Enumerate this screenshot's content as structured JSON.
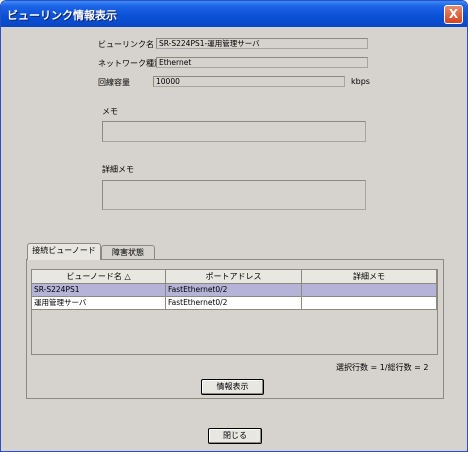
{
  "window": {
    "title": "ビューリンク情報表示",
    "close_label": "X"
  },
  "form": {
    "viewlink_name_label": "ビューリンク名",
    "viewlink_name_value": "SR-S224PS1-運用管理サーバ",
    "network_type_label": "ネットワーク種別",
    "network_type_value": "Ethernet",
    "line_capacity_label": "回線容量",
    "line_capacity_value": "10000",
    "line_capacity_unit": "kbps",
    "memo_label": "メモ",
    "memo_value": "",
    "detail_memo_label": "詳細メモ",
    "detail_memo_value": ""
  },
  "tabs": [
    {
      "label": "接続ビューノード",
      "active": true
    },
    {
      "label": "障害状態",
      "active": false
    }
  ],
  "table": {
    "columns": [
      "ビューノード名 △",
      "ポートアドレス",
      "詳細メモ"
    ],
    "rows": [
      {
        "node": "SR-S224PS1",
        "port": "FastEthernet0/2",
        "memo": "",
        "selected": true
      },
      {
        "node": "運用管理サーバ",
        "port": "FastEthernet0/2",
        "memo": "",
        "selected": false
      }
    ]
  },
  "status": {
    "selection_count": "選択行数 = 1/総行数 = 2"
  },
  "buttons": {
    "info_label": "情報表示",
    "close_label": "閉じる"
  }
}
